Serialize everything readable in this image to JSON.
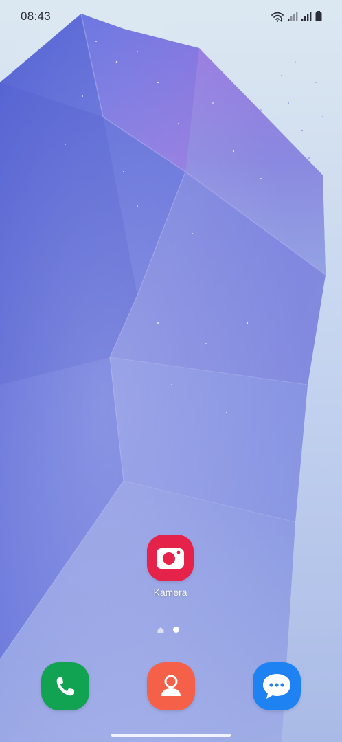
{
  "status_bar": {
    "time": "08:43",
    "icons": [
      "wifi-icon",
      "signal-icon",
      "signal-icon",
      "battery-icon"
    ]
  },
  "home_screen": {
    "apps": [
      {
        "label": "Kamera",
        "icon": "camera-icon",
        "color": "#e5224a"
      }
    ],
    "page_indicator": {
      "pages": [
        "home",
        "page"
      ],
      "active_index": 1
    }
  },
  "dock": {
    "apps": [
      {
        "icon": "phone-icon",
        "color": "#12a352"
      },
      {
        "icon": "contacts-icon",
        "color": "#f46048"
      },
      {
        "icon": "messages-icon",
        "color": "#1f82f2"
      }
    ]
  },
  "colors": {
    "wallpaper_dark": "#5a68d8",
    "wallpaper_light": "#dbe6f2",
    "status_text": "#2b2e3a"
  }
}
